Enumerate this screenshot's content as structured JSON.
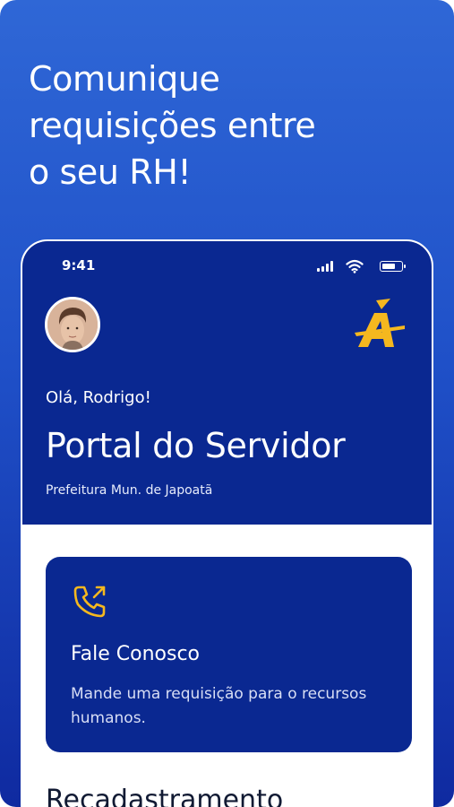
{
  "promo": {
    "headline_lines": [
      "Comunique",
      "requisições entre",
      "o seu RH!"
    ]
  },
  "status_bar": {
    "time": "9:41",
    "icons": [
      "cellular-signal-icon",
      "wifi-icon",
      "battery-icon"
    ]
  },
  "header": {
    "greeting": "Olá, Rodrigo!",
    "title": "Portal do Servidor",
    "subtitle": "Prefeitura Mun. de Japoatã",
    "avatar": "user-avatar",
    "logo": "a-accent-logo"
  },
  "contact_card": {
    "icon": "phone-outgoing-icon",
    "title": "Fale Conosco",
    "description": "Mande uma requisição para o recursos humanos."
  },
  "next_section": {
    "title": "Recadastramento"
  },
  "colors": {
    "background_top": "#2f67d6",
    "background_bottom": "#0f2aa0",
    "navy": "#0a2891",
    "accent_yellow": "#f5b81f",
    "white": "#ffffff"
  }
}
